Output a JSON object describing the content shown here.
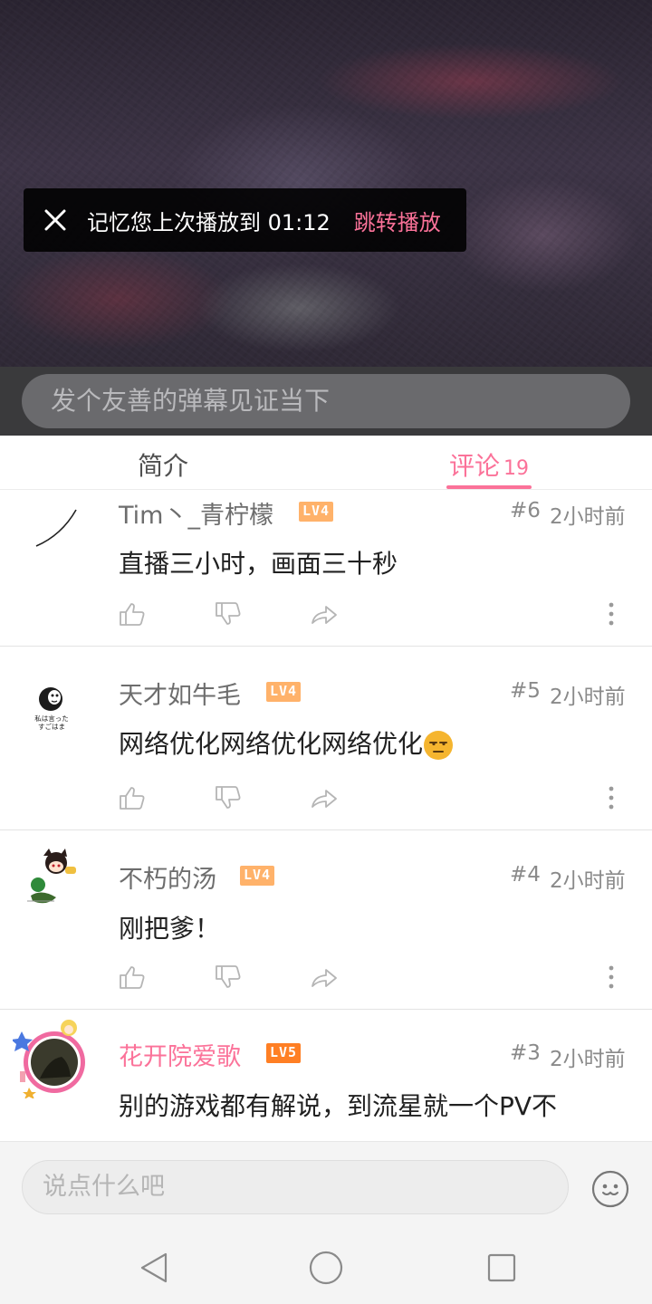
{
  "video": {
    "toast_text": "记忆您上次播放到 01:12",
    "toast_action": "跳转播放"
  },
  "danmaku": {
    "placeholder": "发个友善的弹幕见证当下"
  },
  "tabs": {
    "intro": "简介",
    "comments": "评论",
    "comments_count": "19"
  },
  "comments": [
    {
      "user": "Tim丶_青柠檬",
      "level": "LV4",
      "floor": "#6",
      "time": "2小时前",
      "text": "直播三小时，画面三十秒"
    },
    {
      "user": "天才如牛毛",
      "level": "LV4",
      "floor": "#5",
      "time": "2小时前",
      "text": "网络优化网络优化网络优化",
      "avatar_caption_1": "私は言った",
      "avatar_caption_2": "すごはま"
    },
    {
      "user": "不朽的汤",
      "level": "LV4",
      "floor": "#4",
      "time": "2小时前",
      "text": "刚把爹！"
    },
    {
      "user": "花开院爱歌",
      "level": "LV5",
      "floor": "#3",
      "time": "2小时前",
      "text": "别的游戏都有解说，到流星就一个PV不"
    }
  ],
  "reply": {
    "placeholder": "说点什么吧"
  },
  "colors": {
    "accent": "#fb7299",
    "level4": "#ffb26a",
    "level5": "#ff7f24"
  },
  "icons": {
    "close": "close-icon",
    "like": "thumb-up-icon",
    "dislike": "thumb-down-icon",
    "share": "share-icon",
    "more": "more-vertical-icon",
    "emoji": "emoji-icon",
    "back": "back-triangle-icon",
    "home": "home-circle-icon",
    "recent": "recent-square-icon"
  }
}
